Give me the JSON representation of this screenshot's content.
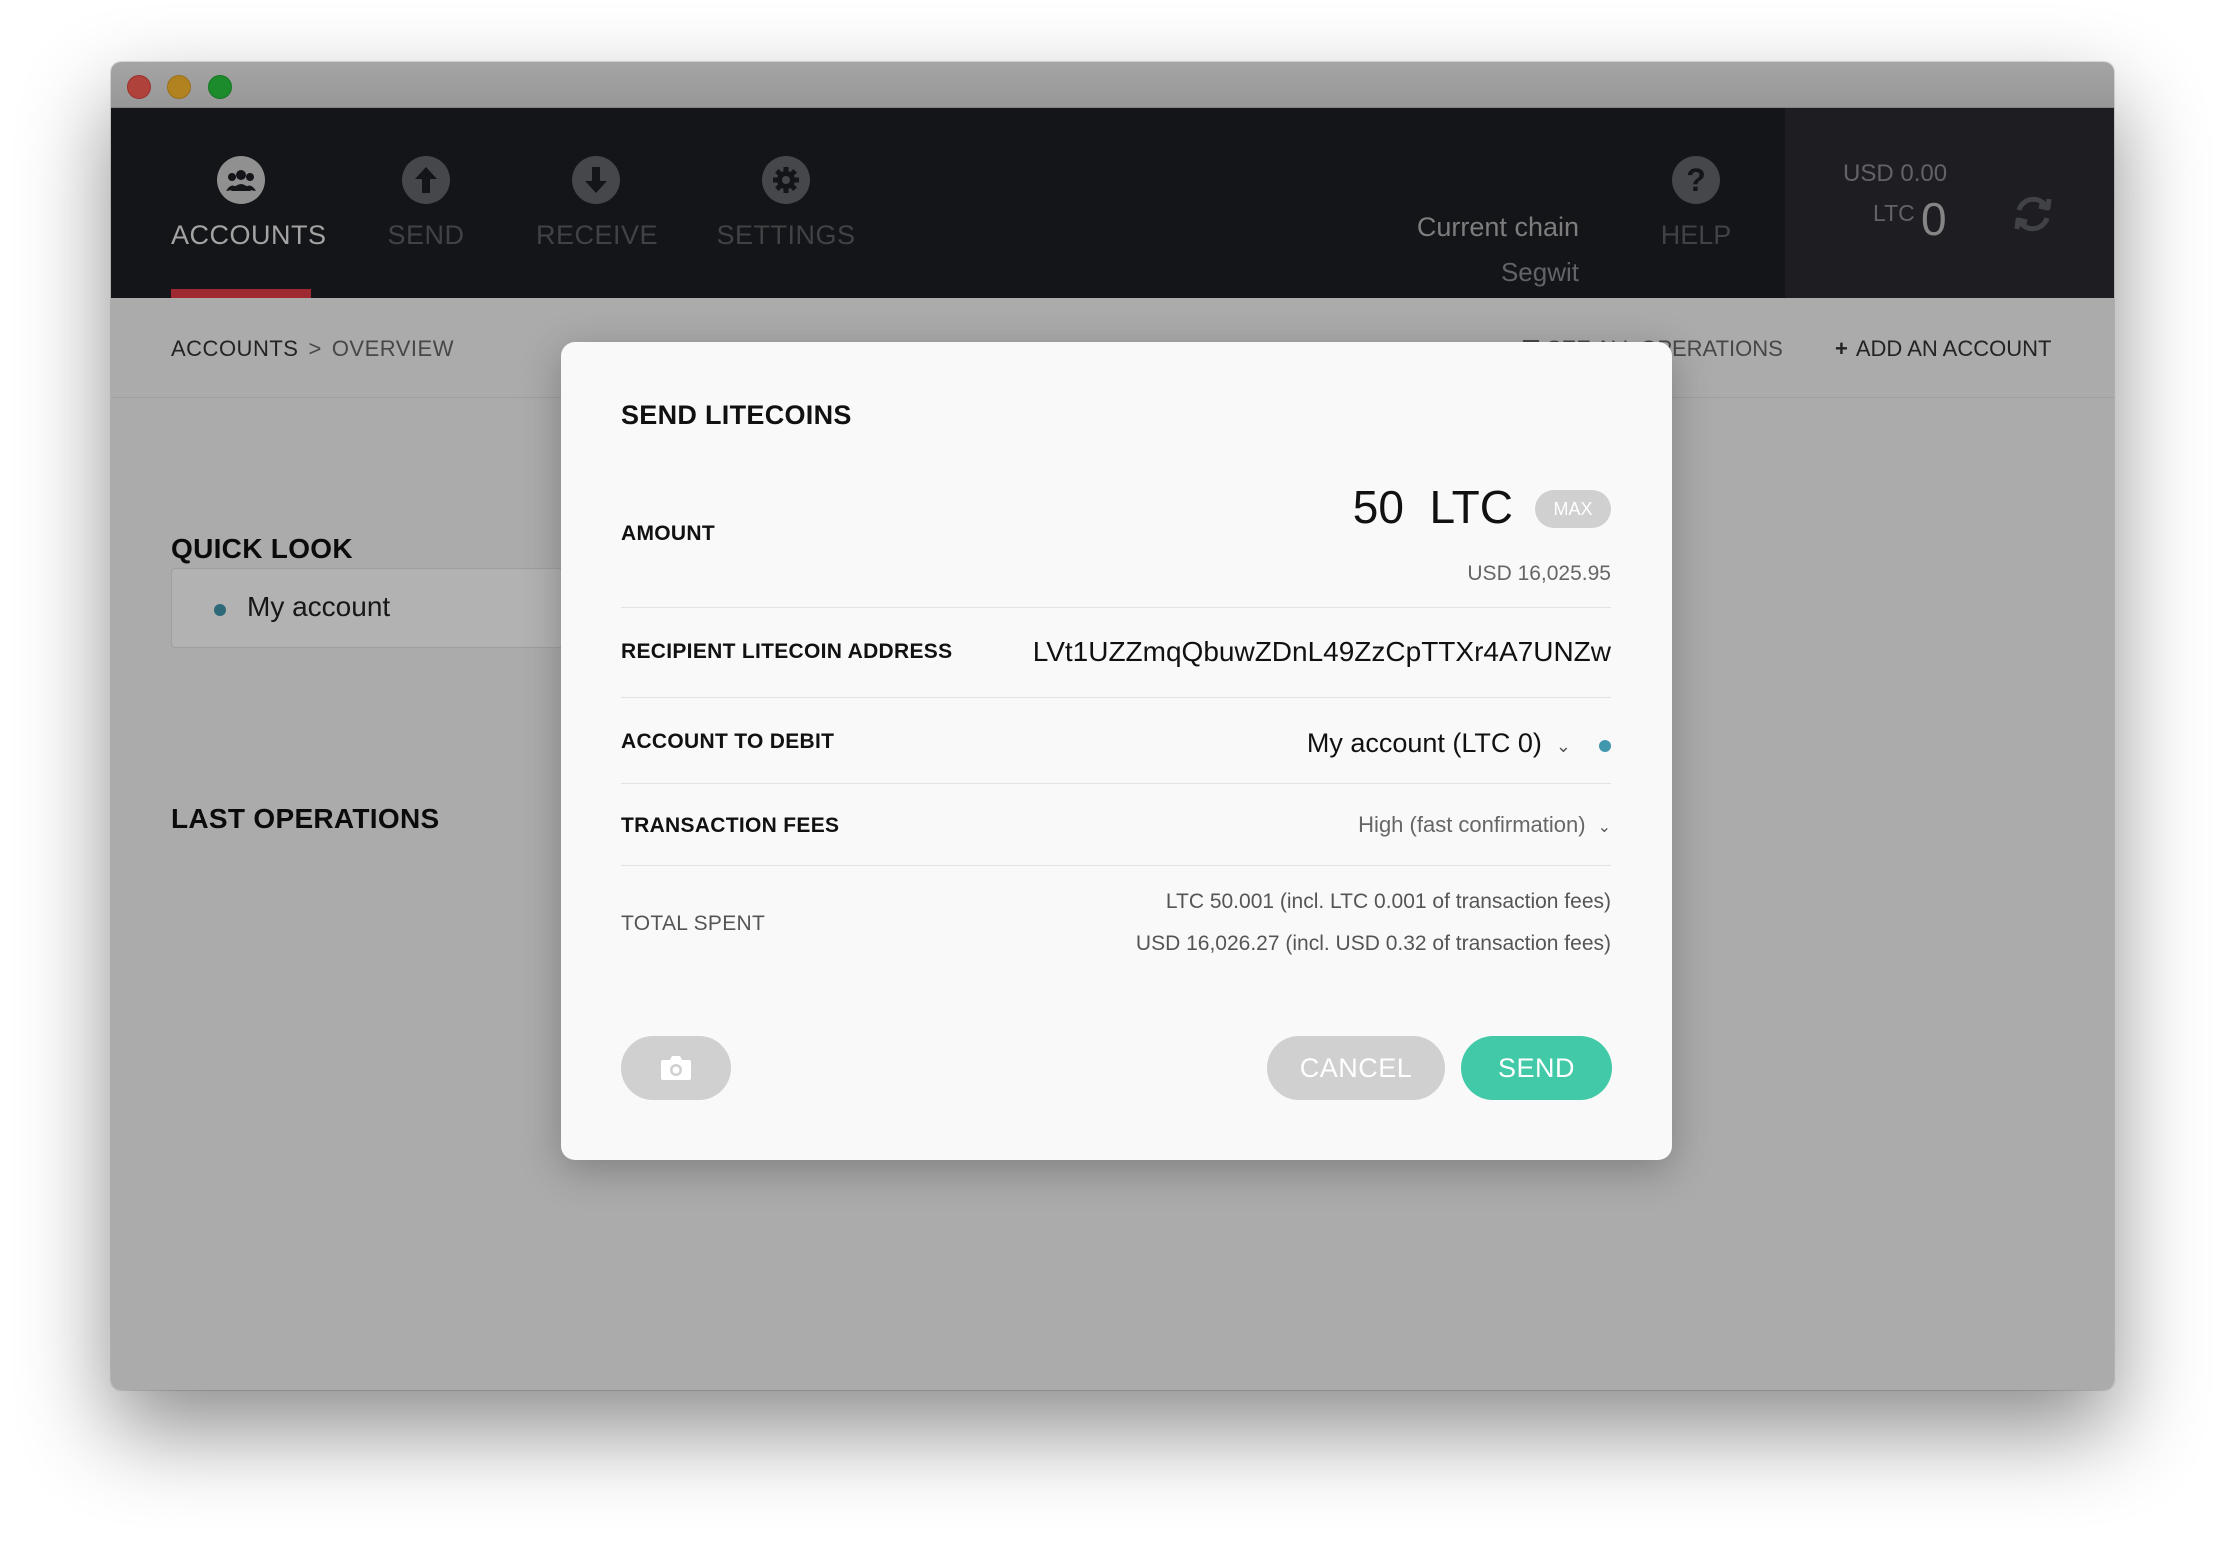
{
  "nav": {
    "accounts": "ACCOUNTS",
    "send": "SEND",
    "receive": "RECEIVE",
    "settings": "SETTINGS",
    "help": "HELP",
    "accent_color": "#e33c46"
  },
  "chain": {
    "label": "Current chain",
    "value": "Segwit"
  },
  "balance": {
    "usd": "USD 0.00",
    "ltc_label": "LTC",
    "ltc_value": "0"
  },
  "breadcrumb": {
    "root": "ACCOUNTS",
    "separator": ">",
    "current": "OVERVIEW"
  },
  "actions": {
    "see_all": "SEE ALL OPERATIONS",
    "add_account": "ADD AN ACCOUNT"
  },
  "main": {
    "quick_look": "QUICK LOOK",
    "account_name": "My account",
    "last_operations": "LAST OPERATIONS"
  },
  "modal": {
    "title": "SEND LITECOINS",
    "amount_label": "AMOUNT",
    "amount_value": "50",
    "amount_unit": "LTC",
    "max_label": "MAX",
    "amount_usd": "USD 16,025.95",
    "recipient_label": "RECIPIENT LITECOIN ADDRESS",
    "recipient_value": "LVt1UZZmqQbuwZDnL49ZzCpTTXr4A7UNZw",
    "debit_label": "ACCOUNT TO DEBIT",
    "debit_value": "My account (LTC 0)",
    "fees_label": "TRANSACTION FEES",
    "fees_value": "High (fast confirmation)",
    "total_label": "TOTAL SPENT",
    "total_ltc": "LTC 50.001 (incl. LTC 0.001 of transaction fees)",
    "total_usd": "USD 16,026.27 (incl. USD 0.32 of transaction fees)",
    "cancel_label": "CANCEL",
    "send_label": "SEND",
    "send_color": "#41c9a8"
  }
}
